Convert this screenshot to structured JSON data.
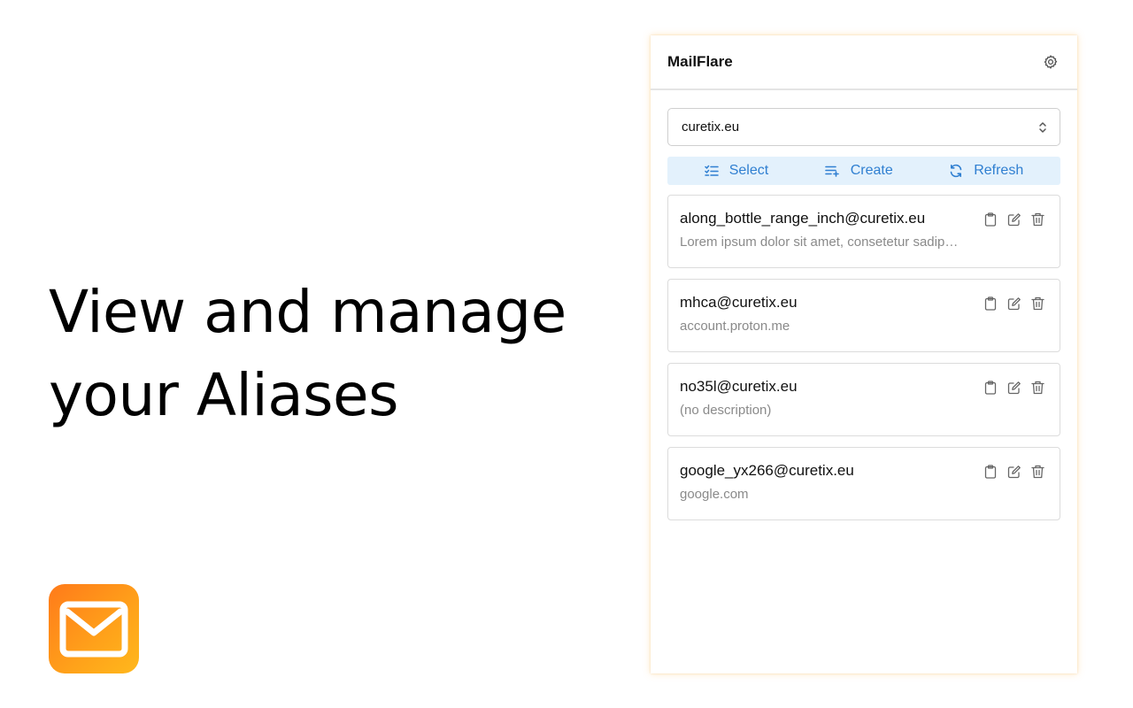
{
  "headline": {
    "line1": "View and manage",
    "line2": "your Aliases"
  },
  "logo": {
    "icon": "mail-envelope-icon",
    "colors": {
      "start": "#ff7a1a",
      "end": "#ffb81c"
    }
  },
  "app": {
    "title": "MailFlare",
    "settings_icon": "gear-icon",
    "domain_select": {
      "value": "curetix.eu",
      "icon": "chevron-up-down-icon"
    },
    "toolbar": {
      "select_label": "Select",
      "create_label": "Create",
      "refresh_label": "Refresh",
      "accent_color": "#2f7fd1",
      "background_color": "#e3f1fc"
    },
    "aliases": [
      {
        "email": "along_bottle_range_inch@curetix.eu",
        "description": "Lorem ipsum dolor sit amet, consetetur sadipscing elitr"
      },
      {
        "email": "mhca@curetix.eu",
        "description": "account.proton.me"
      },
      {
        "email": "no35l@curetix.eu",
        "description": "(no description)"
      },
      {
        "email": "google_yx266@curetix.eu",
        "description": "google.com"
      }
    ],
    "alias_action_icons": [
      "clipboard-icon",
      "edit-icon",
      "trash-icon"
    ]
  }
}
